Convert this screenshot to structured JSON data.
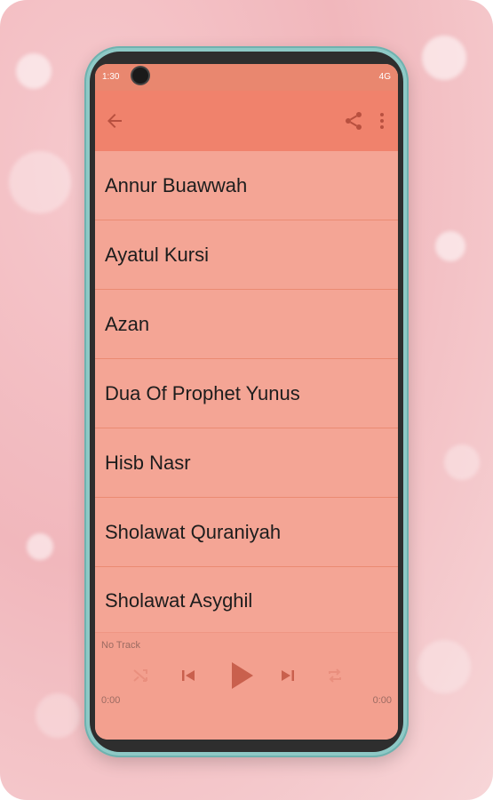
{
  "status_bar": {
    "time": "1:30",
    "signal_label": "4G"
  },
  "toolbar": {
    "back_icon": "arrow-left-icon",
    "share_icon": "share-icon",
    "more_icon": "more-vertical-icon"
  },
  "list": {
    "items": [
      {
        "label": "Annur Buawwah"
      },
      {
        "label": "Ayatul Kursi"
      },
      {
        "label": "Azan"
      },
      {
        "label": "Dua Of Prophet Yunus"
      },
      {
        "label": "Hisb Nasr"
      },
      {
        "label": "Sholawat Quraniyah"
      },
      {
        "label": "Sholawat Asyghil"
      }
    ]
  },
  "player": {
    "track_name": "No Track",
    "elapsed": "0:00",
    "duration": "0:00",
    "controls": [
      "shuffle-icon",
      "previous-icon",
      "play-icon",
      "next-icon",
      "repeat-icon"
    ]
  },
  "colors": {
    "accent": "#f0826c",
    "list_background": "#f4a595",
    "divider": "#ea8a72",
    "phone_frame": "#8ec9c6"
  }
}
